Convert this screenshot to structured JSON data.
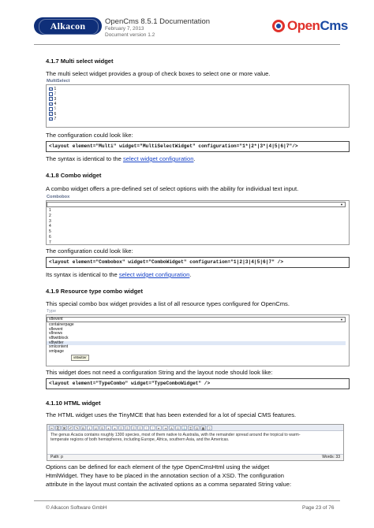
{
  "header": {
    "left_logo": "Alkacon",
    "title": "OpenCms 8.5.1 Documentation",
    "date": "February 7, 2013",
    "version": "Document version 1.2",
    "right_logo_a": "Open",
    "right_logo_b": "Cms"
  },
  "multi": {
    "heading": "4.1.7     Multi select widget",
    "intro": "The multi select widget provides a group of check boxes to select one or more value.",
    "widget_label": "MultiSelect",
    "options": [
      {
        "label": "1",
        "checked": true
      },
      {
        "label": "2",
        "checked": false
      },
      {
        "label": "3",
        "checked": true
      },
      {
        "label": "4",
        "checked": true
      },
      {
        "label": "5",
        "checked": false
      },
      {
        "label": "6",
        "checked": true
      },
      {
        "label": "7",
        "checked": true
      }
    ],
    "config_intro": "The configuration could look like:",
    "code": "<layout element=\"Multi\" widget=\"MultiSelectWidget\" configuration=\"1*|2*|3*|4|5|6|7\"/>",
    "syntax_prefix": "The syntax is identical to the ",
    "syntax_link": "select widget configuration",
    "syntax_suffix": "."
  },
  "combo": {
    "heading": "4.1.8     Combo widget",
    "intro": "A combo widget offers a pre-defined set of select options with the ability for individual text input.",
    "widget_label": "Combobox",
    "options": [
      "1",
      "2",
      "3",
      "4",
      "5",
      "6",
      "7"
    ],
    "config_intro": "The configuration could look like:",
    "code": "<layout element=\"Combobox\" widget=\"ComboWidget\" configuration=\"1|2|3|4|5|6|7\" />",
    "syntax_prefix": "Its syntax is identical to the ",
    "syntax_link": "select widget configuration",
    "syntax_suffix": "."
  },
  "typecombo": {
    "heading": "4.1.9     Resource type combo widget",
    "intro": "This special combo box widget provides a list of all resource types configured for OpenCms.",
    "widget_label": "Type",
    "current_value": "v8event",
    "options": [
      "containerpage",
      "v8event",
      "v8news",
      "v8twitblock",
      "v8twitter",
      "xmlcontent",
      "xmlpage"
    ],
    "selected_option": "v8twitter",
    "tooltip": "v8twitter",
    "note": "This widget does not need a configuration String and the layout node should look like:",
    "code": "<layout element=\"TypeCombo\" widget=\"TypeComboWidget\" />"
  },
  "html": {
    "heading": "4.1.10    HTML widget",
    "intro": "The HTML widget uses the TinyMCE that has been extended for a lot of special CMS features.",
    "toolbar_buttons": [
      "✂",
      "⎘",
      "⌘",
      "↶",
      "↷",
      "B",
      "I",
      "U",
      "S",
      "x",
      "x",
      "≡",
      "≡",
      "≡",
      "≡",
      "⋮",
      "⋮",
      "⇤",
      "⇥",
      "A",
      "☺",
      "⚓",
      "⌗",
      "Ω",
      "▦",
      "?"
    ],
    "editor_text_1": "The genus Acacia contains roughly 1300 species, most of them native to Australia, with the remainder spread around the tropical to warm-",
    "editor_text_2": "temperate regions of both hemispheres, including Europe, Africa, southern Asia, and the Americas.",
    "path": "Path: p",
    "words": "Words: 33",
    "options_text_1": "Options can be defined for each element of the type OpenCmsHtml using the widget",
    "options_text_2": "HtmlWidget. They have to be placed in the annotation section of a XSD. The configuration",
    "options_text_3": "attribute in the layout must contain the activated options as a comma separated String value:"
  },
  "footer": {
    "copyright": "© Alkacon Software GmbH",
    "page": "Page 23 of 76"
  }
}
